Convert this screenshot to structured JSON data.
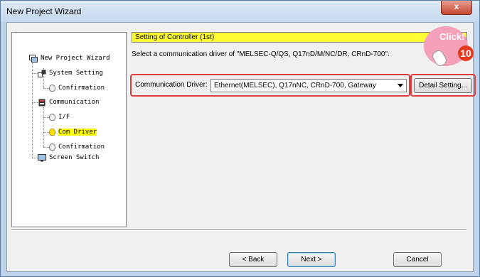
{
  "window": {
    "title": "New Project Wizard",
    "close_glyph": "x"
  },
  "tree": {
    "items": [
      {
        "label": "New Project Wizard",
        "icon": "project-icon"
      },
      {
        "label": "System Setting",
        "icon": "system-icon"
      },
      {
        "label": "Confirmation",
        "icon": "bulb-icon"
      },
      {
        "label": "Communication",
        "icon": "communication-icon"
      },
      {
        "label": "I/F",
        "icon": "bulb-icon"
      },
      {
        "label": "Com Driver",
        "icon": "bulb-on-icon",
        "selected": true
      },
      {
        "label": "Confirmation",
        "icon": "bulb-icon"
      },
      {
        "label": "Screen Switch",
        "icon": "screen-icon"
      }
    ]
  },
  "main": {
    "header": "Setting of Controller (1st)",
    "description": "Select a communication driver of \"MELSEC-Q/QS, Q17nD/M/NC/DR, CRnD-700\".",
    "driver_label": "Communication Driver:",
    "driver_value": "Ethernet(MELSEC), Q17nNC, CRnD-700, Gateway",
    "detail_button": "Detail Setting..."
  },
  "footer": {
    "back": "< Back",
    "next": "Next >",
    "cancel": "Cancel"
  },
  "callout": {
    "text": "Click!",
    "number": "10"
  },
  "colors": {
    "highlight_border": "#e03a3a",
    "header_bg": "#ffff33",
    "callout_pink": "#f3a0b8",
    "badge_red": "#e5391e"
  }
}
